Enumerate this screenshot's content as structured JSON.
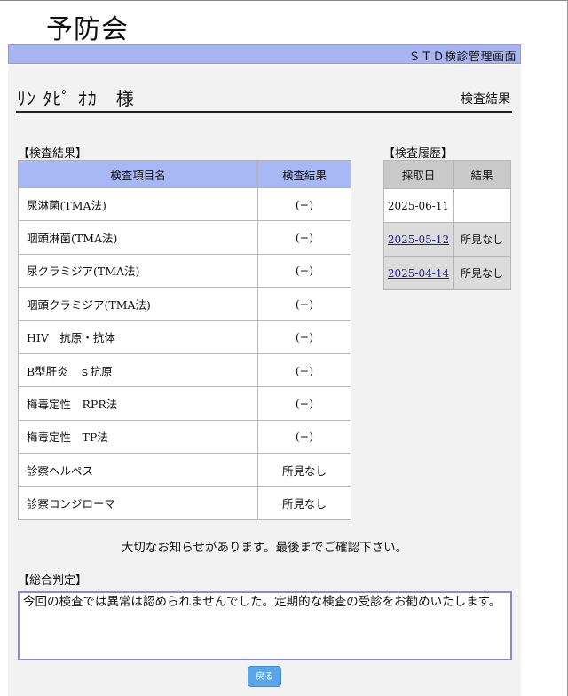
{
  "header": {
    "logo_text": "予防会",
    "banner_title": "ＳＴＤ検診管理画面"
  },
  "patient": {
    "name": "ﾘﾝ ﾀﾋﾟ ｵｶ　様",
    "page_title": "検査結果"
  },
  "results": {
    "section_label": "【検査結果】",
    "columns": [
      "検査項目名",
      "検査結果"
    ],
    "rows": [
      {
        "item": "尿淋菌(TMA法)",
        "result": "(−)"
      },
      {
        "item": "咽頭淋菌(TMA法)",
        "result": "(−)"
      },
      {
        "item": "尿クラミジア(TMA法)",
        "result": "(−)"
      },
      {
        "item": "咽頭クラミジア(TMA法)",
        "result": "(−)"
      },
      {
        "item": "HIV　抗原・抗体",
        "result": "(−)"
      },
      {
        "item": "B型肝炎　ｓ抗原",
        "result": "(−)"
      },
      {
        "item": "梅毒定性　RPR法",
        "result": "(−)"
      },
      {
        "item": "梅毒定性　TP法",
        "result": "(−)"
      },
      {
        "item": "診察ヘルペス",
        "result": "所見なし"
      },
      {
        "item": "診察コンジローマ",
        "result": "所見なし"
      }
    ]
  },
  "history": {
    "section_label": "【検査履歴】",
    "columns": [
      "採取日",
      "結果"
    ],
    "rows": [
      {
        "date": "2025-06-11",
        "result": ""
      },
      {
        "date": "2025-05-12",
        "result": "所見なし"
      },
      {
        "date": "2025-04-14",
        "result": "所見なし"
      }
    ]
  },
  "notice": "大切なお知らせがあります。最後までご確認下さい。",
  "judgment": {
    "section_label": "【総合判定】",
    "text": "今回の検査では異常は認められませんでした。定期的な検査の受診をお勧めいたします。"
  },
  "back_button_label": "戻る"
}
